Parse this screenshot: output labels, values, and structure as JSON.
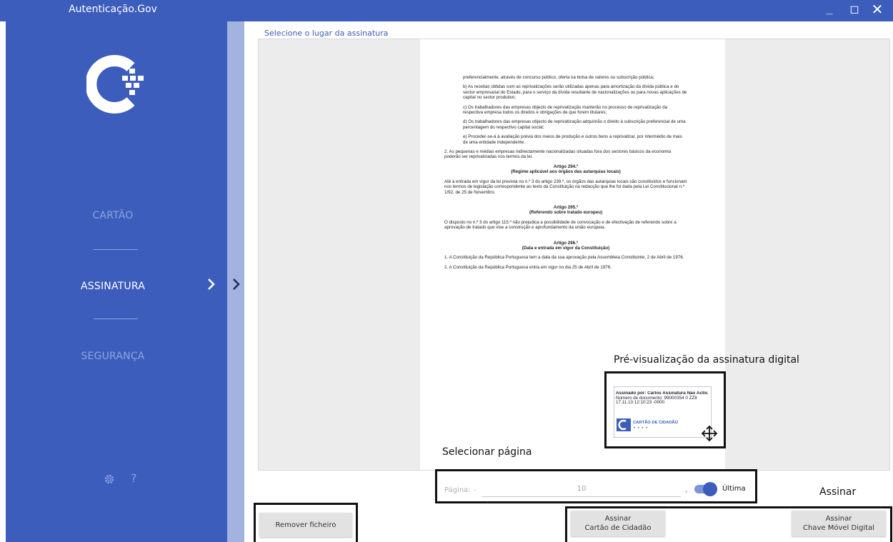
{
  "window": {
    "title": "Autenticação.Gov",
    "minimize": "_",
    "maximize": "◻",
    "close": "✕"
  },
  "sidebar": {
    "items": [
      {
        "label": "CARTÃO",
        "active": false
      },
      {
        "label": "ASSINATURA",
        "active": true
      },
      {
        "label": "SEGURANÇA",
        "active": false
      }
    ],
    "help": "?"
  },
  "main": {
    "section_title": "Selecione o lugar da assinatura",
    "document": {
      "paragraphs": [
        "preferencialmente, através de concurso público, oferta na bolsa de valores ou subscrição pública;",
        "b) As receitas obtidas com as reprivatizações serão utilizadas apenas para amortização da dívida pública e do sector empresarial do Estado, para o serviço da dívida resultante de nacionalizações ou para novas aplicações de capital no sector produtivo;",
        "c) Os trabalhadores das empresas objecto de reprivatização manterão no processo de reprivatização da respectiva empresa todos os direitos e obrigações de que forem titulares;",
        "d) Os trabalhadores das empresas objecto de reprivatização adquirirão o direito à subscrição preferencial de uma percentagem do respectivo capital social;",
        "e) Proceder-se-á à avaliação prévia dos meios de produção e outros bens a reprivatizar, por intermédio de mais de uma entidade independente.",
        "2. As pequenas e médias empresas indirectamente nacionalizadas situadas fora dos sectores básicos da economia poderão ser reprivatizadas nos termos da lei.",
        "Artigo 294.º",
        "(Regime aplicável aos órgãos das autarquias locais)",
        "Até à entrada em vigor da lei prevista no n.º 3 do artigo 239.º, os órgãos das autarquias locais são constituídos e funcionam nos termos de legislação correspondente ao texto da Constituição na redacção que lhe foi dada pela Lei Constitucional n.º 1/92, de 25 de Novembro.",
        "Artigo 295.º",
        "(Referendo sobre tratado europeu)",
        "O disposto no n.º 3 do artigo 115.º não prejudica a possibilidade de convocação e de efectivação de referendo sobre a aprovação de tratado que vise a construção e aprofundamento da união europeia.",
        "Artigo 296.º",
        "(Data e entrada em vigor da Constituição)",
        "1. A Constituição da República Portuguesa tem a data da sua aprovação pela Assembleia Constituinte, 2 de Abril de 1976.",
        "2. A Constituição da República Portuguesa entra em vigor no dia 25 de Abril de 1976."
      ]
    },
    "signature_preview": {
      "label": "Pré-visualização da assinatura digital",
      "line1": "Assinado por: Carlos Assinatura Não Activ.",
      "line2": "Número de documento: 99000354 0 ZZ8",
      "line3": "17.11.13 12:10:23 -0000",
      "card_label": "CARTÃO DE CIDADÃO",
      "card_dots": "• • • •"
    },
    "page_selector": {
      "annotation": "Selecionar página",
      "label": "Página:",
      "minus": "-",
      "value": "10",
      "plus": "+",
      "last_label": "Última",
      "last_enabled": true
    },
    "buttons": {
      "remove_file": "Remover ficheiro",
      "sign_annotation": "Assinar",
      "sign_cc_line1": "Assinar",
      "sign_cc_line2": "Cartão de Cidadão",
      "sign_cmd_line1": "Assinar",
      "sign_cmd_line2": "Chave Móvel Digital"
    }
  },
  "colors": {
    "brand": "#3c5dbc",
    "sidebar_inactive": "#8ea3e0",
    "subpanel": "#a3b3e0"
  }
}
